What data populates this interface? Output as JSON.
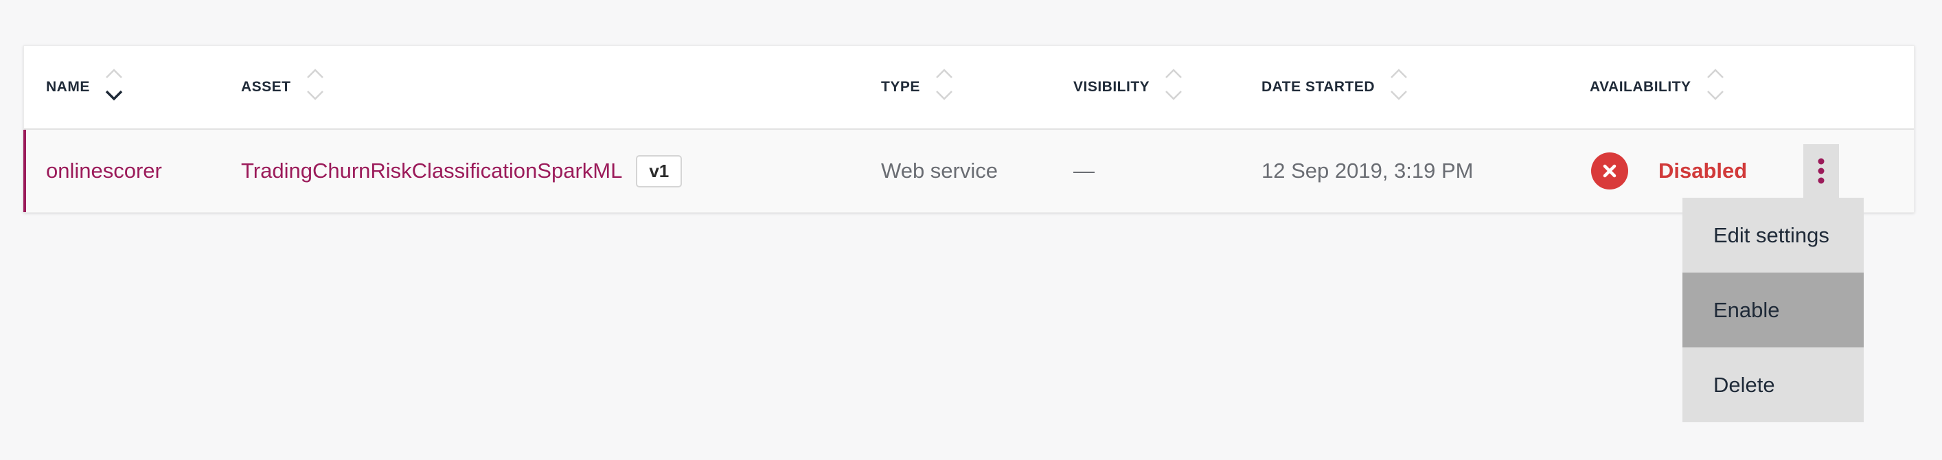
{
  "table": {
    "columns": [
      {
        "key": "name",
        "label": "NAME",
        "sort": "descending"
      },
      {
        "key": "asset",
        "label": "ASSET",
        "sort": "none"
      },
      {
        "key": "type",
        "label": "TYPE",
        "sort": "none"
      },
      {
        "key": "visibility",
        "label": "VISIBILITY",
        "sort": "none"
      },
      {
        "key": "date_started",
        "label": "DATE STARTED",
        "sort": "none"
      },
      {
        "key": "availability",
        "label": "AVAILABILITY",
        "sort": "none"
      }
    ],
    "rows": [
      {
        "name": "onlinescorer",
        "asset": "TradingChurnRiskClassificationSparkML",
        "version": "v1",
        "type": "Web service",
        "visibility": "—",
        "date_started": "12 Sep 2019, 3:19 PM",
        "availability": "Disabled",
        "status_icon": "error-x-icon"
      }
    ]
  },
  "overflow_menu": {
    "icon": "kebab-vertical-icon",
    "items": [
      {
        "label": "Edit settings"
      },
      {
        "label": "Enable",
        "hovered": true
      },
      {
        "label": "Delete"
      }
    ]
  },
  "colors": {
    "accent": "#9b1b5a",
    "error": "#d93a3a",
    "page_bg": "#f7f7f8",
    "menu_bg": "#dfdfdf",
    "menu_hover": "#a9a9a9"
  }
}
